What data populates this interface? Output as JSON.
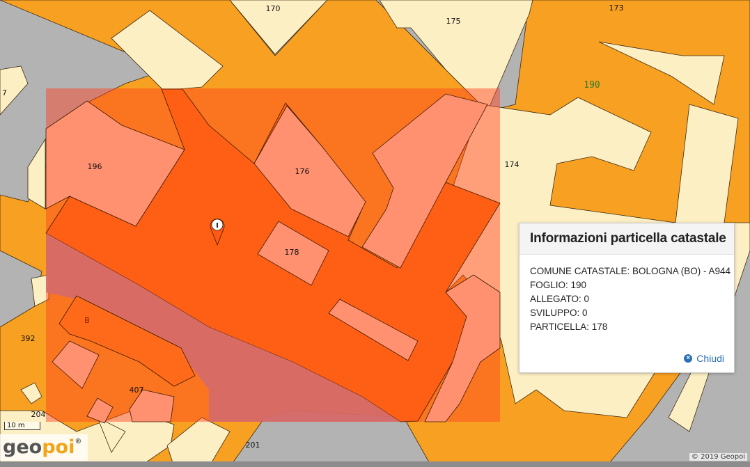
{
  "map": {
    "parcel_labels": {
      "p170": "170",
      "p175": "175",
      "p173": "173",
      "p190": "190",
      "p7": "7",
      "p196": "196",
      "p176": "176",
      "p174": "174",
      "p178": "178",
      "p392": "392",
      "pB": "B",
      "p407": "407",
      "p204": "204",
      "p201": "201"
    },
    "marker_glyph": "I",
    "colors": {
      "parcel_orange": "#f8a021",
      "parcel_cream": "#fdefc4",
      "road_gray": "#b3b3b3",
      "highlight_fill": "#ff3d1f",
      "selected_parcel": "#ff5f14"
    }
  },
  "popup": {
    "title": "Informazioni particella catastale",
    "rows": [
      "COMUNE CATASTALE: BOLOGNA (BO) - A944",
      "FOGLIO: 190",
      "ALLEGATO: 0",
      "SVILUPPO: 0",
      "PARTICELLA: 178"
    ],
    "close_label": "Chiudi"
  },
  "scale_label": "10 m",
  "logo": {
    "geo": "geo",
    "poi": "poi",
    "reg": "®"
  },
  "attribution": "© 2019 Geopoi"
}
